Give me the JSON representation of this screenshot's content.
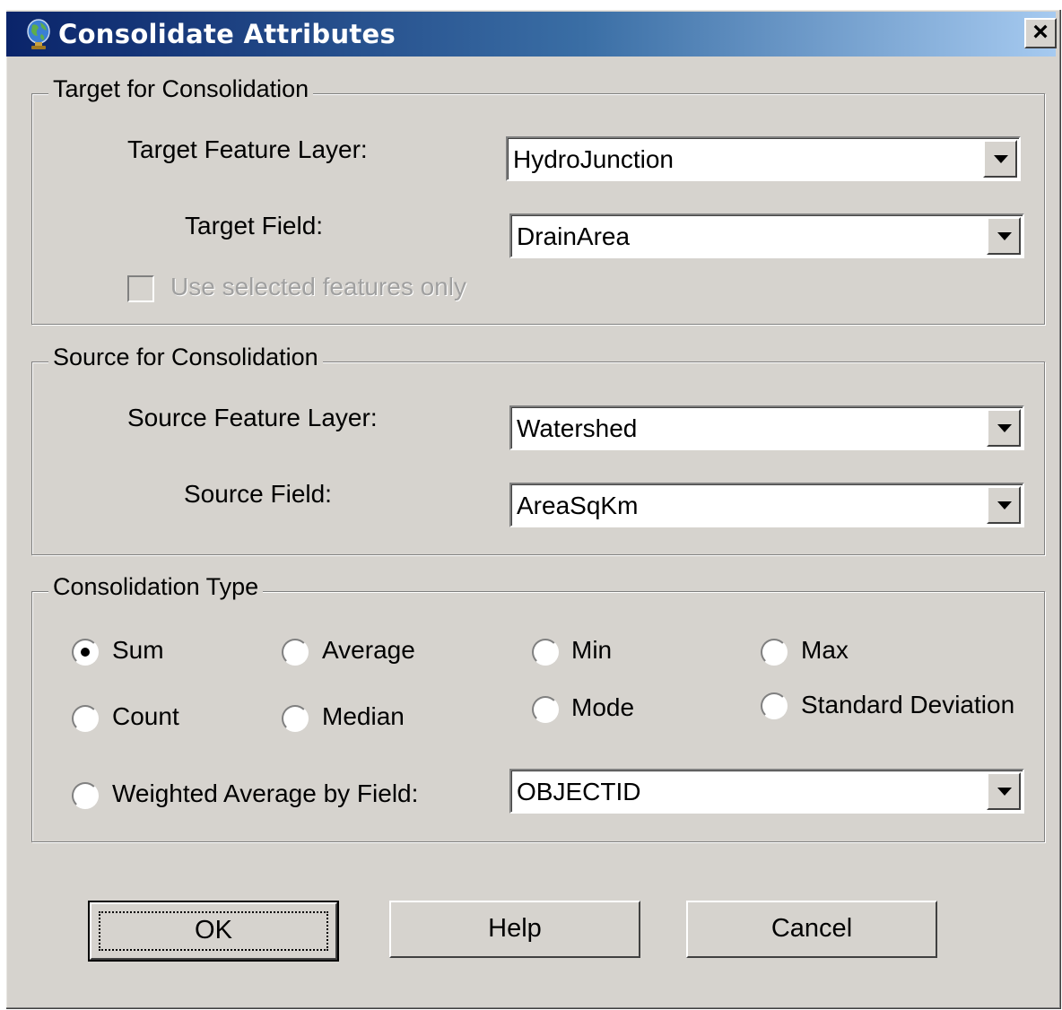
{
  "window": {
    "title": "Consolidate Attributes",
    "close_label": "×",
    "icon": "globe-icon"
  },
  "target": {
    "legend": "Target for Consolidation",
    "feature_layer_label": "Target Feature Layer:",
    "feature_layer_value": "HydroJunction",
    "field_label": "Target Field:",
    "field_value": "DrainArea",
    "selected_only_label": "Use selected features only"
  },
  "source": {
    "legend": "Source for Consolidation",
    "feature_layer_label": "Source Feature Layer:",
    "feature_layer_value": "Watershed",
    "field_label": "Source Field:",
    "field_value": "AreaSqKm"
  },
  "consolidation": {
    "legend": "Consolidation Type",
    "options": {
      "sum": "Sum",
      "average": "Average",
      "min": "Min",
      "max": "Max",
      "count": "Count",
      "median": "Median",
      "mode": "Mode",
      "std": "Standard Deviation",
      "weighted": "Weighted Average by Field:"
    },
    "selected": "Sum",
    "weighted_field_value": "OBJECTID"
  },
  "buttons": {
    "ok": "OK",
    "help": "Help",
    "cancel": "Cancel"
  },
  "colors": {
    "dialog_bg": "#d6d3ce",
    "titlebar_start": "#0a246a",
    "titlebar_end": "#a6caf0"
  }
}
